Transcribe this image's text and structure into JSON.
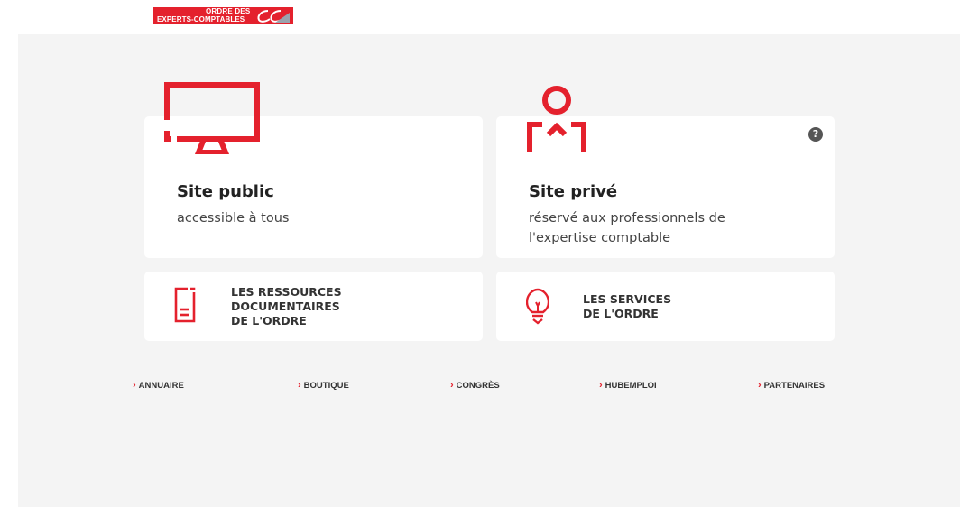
{
  "logo": {
    "line1": "ORDRE DES",
    "line2": "EXPERTS-COMPTABLES"
  },
  "cards": {
    "public": {
      "title": "Site public",
      "subtitle": "accessible à tous"
    },
    "private": {
      "title": "Site privé",
      "subtitle_line1": "réservé aux professionnels de",
      "subtitle_line2": "l'expertise comptable",
      "help": "?"
    },
    "resources": {
      "line1": "LES RESSOURCES",
      "line2": "DOCUMENTAIRES",
      "line3": "DE L'ORDRE"
    },
    "services": {
      "line1": "LES SERVICES",
      "line2": "DE L'ORDRE"
    }
  },
  "links": [
    "ANNUAIRE",
    "BOUTIQUE",
    "CONGRÈS",
    "HUBEMPLOI",
    "PARTENAIRES"
  ],
  "colors": {
    "brand_red": "#e4212d",
    "panel_bg": "#f4f4f4"
  }
}
